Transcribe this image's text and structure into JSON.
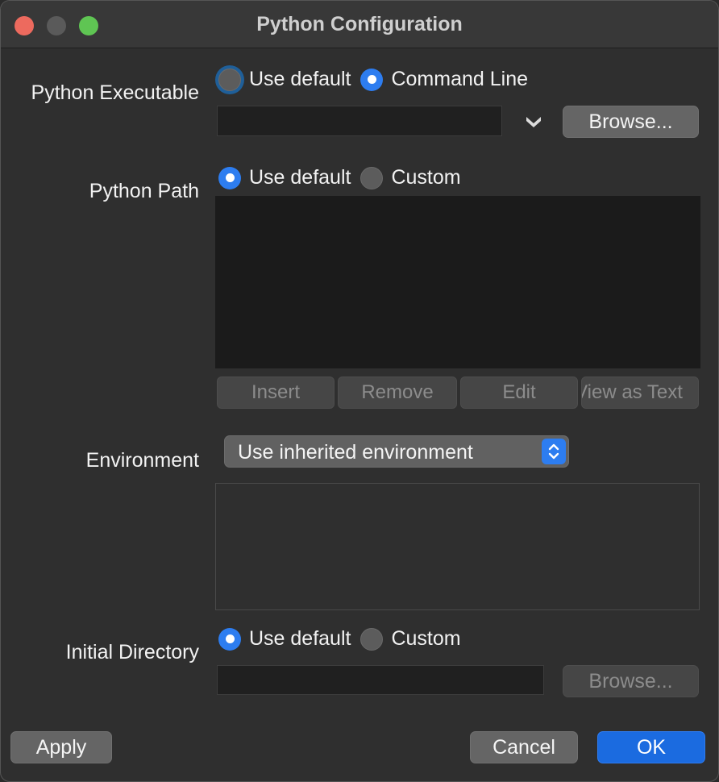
{
  "window": {
    "title": "Python Configuration"
  },
  "python_executable": {
    "label": "Python Executable",
    "option_default": "Use default",
    "option_command_line": "Command Line",
    "selected": "Command Line",
    "value": "",
    "browse_label": "Browse..."
  },
  "python_path": {
    "label": "Python Path",
    "option_default": "Use default",
    "option_custom": "Custom",
    "selected": "Use default",
    "buttons": {
      "insert": "Insert",
      "remove": "Remove",
      "edit": "Edit",
      "view_as_text": "View as Text"
    }
  },
  "environment": {
    "label": "Environment",
    "selected_value": "Use inherited environment"
  },
  "initial_directory": {
    "label": "Initial Directory",
    "option_default": "Use default",
    "option_custom": "Custom",
    "selected": "Use default",
    "value": "",
    "browse_label": "Browse..."
  },
  "footer": {
    "apply": "Apply",
    "cancel": "Cancel",
    "ok": "OK"
  },
  "colors": {
    "accent": "#2d7df0",
    "primary_button": "#1b6be0",
    "close": "#ed6a5e",
    "maximize": "#5fc553"
  },
  "icons": [
    "chevron-down-icon",
    "stepper-arrows-icon"
  ]
}
